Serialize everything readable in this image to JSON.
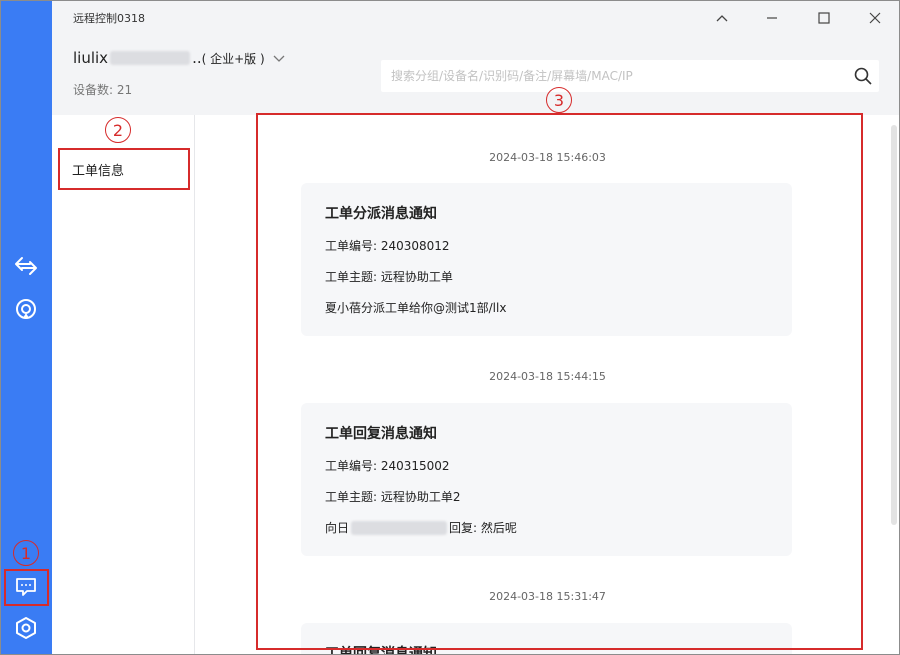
{
  "window": {
    "title": "远程控制0318"
  },
  "account": {
    "name": "liulix",
    "suffix": "..",
    "edition": "( 企业+版 )",
    "device_count_label": "设备数: 21"
  },
  "search": {
    "placeholder": "搜索分组/设备名/识别码/备注/屏幕墙/MAC/IP"
  },
  "sidebar": {
    "items": [
      {
        "label": "工单信息"
      }
    ]
  },
  "messages": [
    {
      "timestamp": "2024-03-18 15:46:03",
      "title": "工单分派消息通知",
      "lines": [
        "工单编号: 240308012",
        "工单主题: 远程协助工单",
        "夏小蓓分派工单给你@测试1部/llx"
      ]
    },
    {
      "timestamp": "2024-03-18 15:44:15",
      "title": "工单回复消息通知",
      "lines": [
        "工单编号: 240315002",
        "工单主题: 远程协助工单2"
      ],
      "reply_prefix": "向日",
      "reply_suffix": "回复: 然后呢"
    },
    {
      "timestamp": "2024-03-18 15:31:47",
      "title": "工单回复消息通知"
    }
  ],
  "annotations": {
    "one": "1",
    "two": "2",
    "three": "3"
  },
  "icons": [
    "switch-arrows-icon",
    "remote-signal-icon",
    "message-icon",
    "settings-hexagon-icon",
    "minimize-icon",
    "maximize-icon",
    "close-icon",
    "chevron-up-icon",
    "chevron-down-icon",
    "search-icon"
  ],
  "colors": {
    "rail": "#3a7cf4",
    "annotation": "#d62b2b"
  }
}
